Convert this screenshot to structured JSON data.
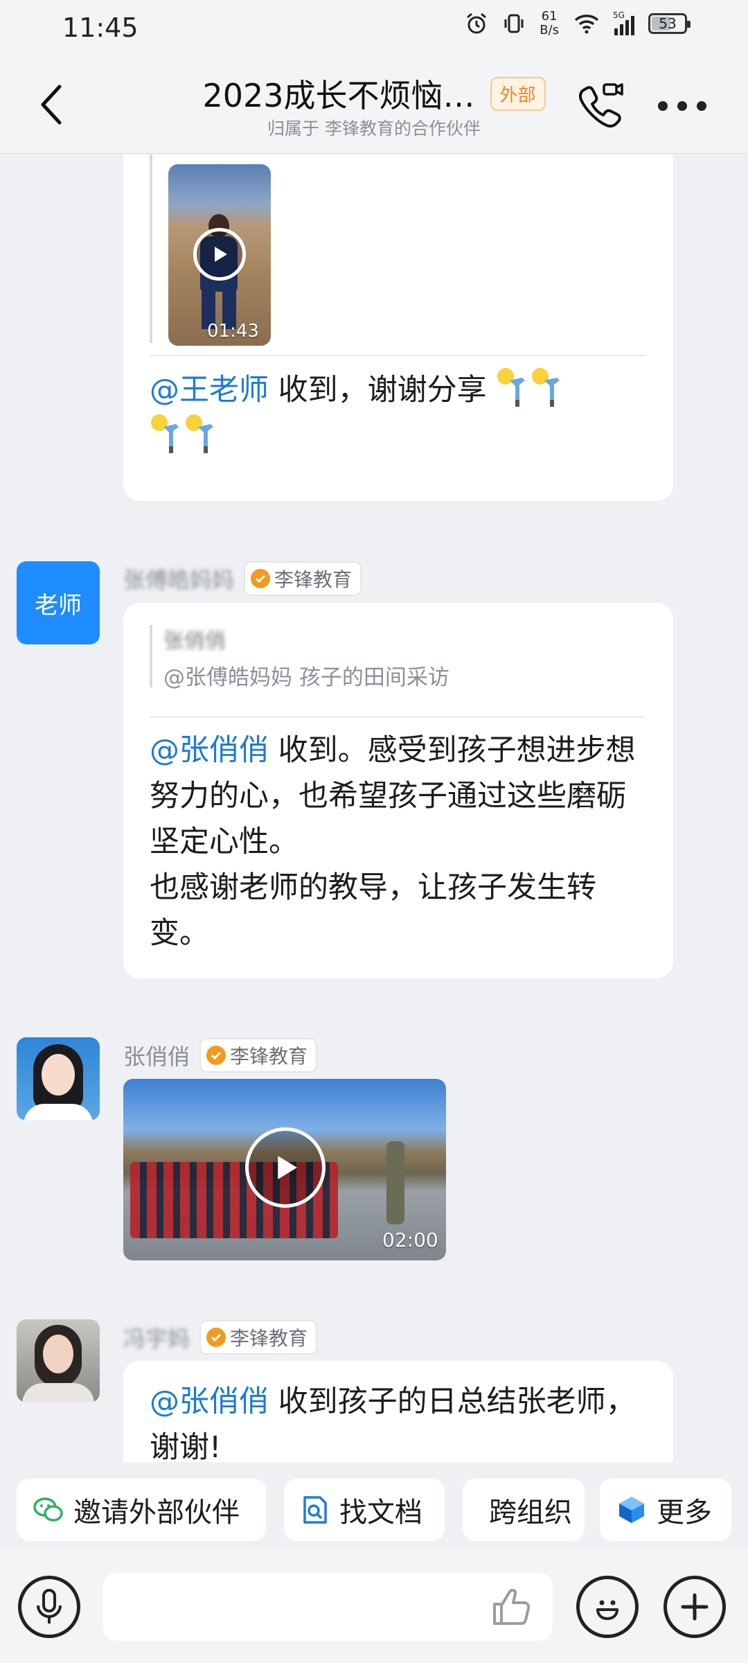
{
  "status_bar": {
    "time": "11:45",
    "net_speed_value": "61",
    "net_speed_unit": "B/s",
    "signal_label": "5G",
    "battery": "53"
  },
  "header": {
    "title": "2023成长不烦恼…",
    "badge": "外部",
    "subtitle": "归属于 李锋教育的合作伙伴"
  },
  "messages": {
    "m1": {
      "video_duration": "01:43",
      "mention": "@王老师",
      "text": " 收到，谢谢分享"
    },
    "m2": {
      "avatar_text": "老师",
      "sender": "张傅皓妈妈",
      "org": "李锋教育",
      "quote_author": "张俏俏",
      "quote_text": "@张傅皓妈妈 孩子的田间采访",
      "mention": "@张俏俏",
      "text": " 收到。感受到孩子想进步想努力的心，也希望孩子通过这些磨砺坚定心性。",
      "text2": "也感谢老师的教导，让孩子发生转变。"
    },
    "m3": {
      "sender": "张俏俏",
      "org": "李锋教育",
      "video_duration": "02:00"
    },
    "m4": {
      "sender": "冯宇妈",
      "org": "李锋教育",
      "mention": "@张俏俏",
      "text": " 收到孩子的日总结张老师，谢谢!"
    }
  },
  "quick_actions": [
    {
      "label": "邀请外部伙伴",
      "icon": "wechat-icon"
    },
    {
      "label": "找文档",
      "icon": "doc-search-icon"
    },
    {
      "label": "跨组织",
      "icon": "stamp-icon"
    },
    {
      "label": "更多",
      "icon": "cube-icon"
    }
  ],
  "input": {
    "placeholder": ""
  },
  "colors": {
    "mention": "#1c7ad8",
    "accent": "#1677ff",
    "badge": "#e5892e"
  }
}
